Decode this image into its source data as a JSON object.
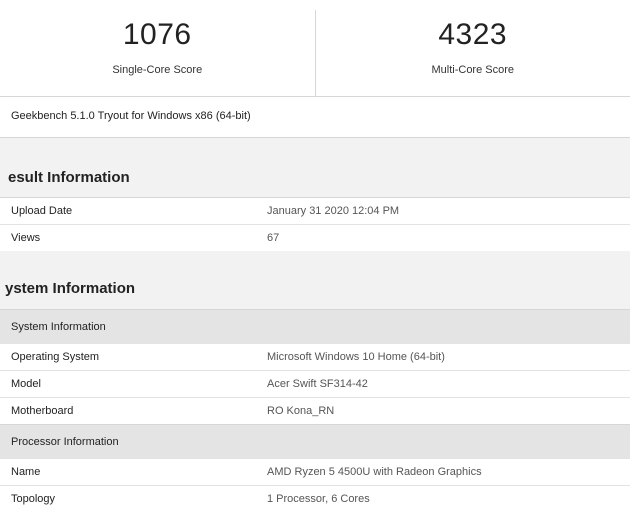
{
  "scores": {
    "single_core": {
      "value": "1076",
      "label": "Single-Core Score"
    },
    "multi_core": {
      "value": "4323",
      "label": "Multi-Core Score"
    }
  },
  "version": "Geekbench 5.1.0 Tryout for Windows x86 (64-bit)",
  "result_information": {
    "title": "esult Information",
    "rows": [
      {
        "name": "Upload Date",
        "value": "January 31 2020 12:04 PM"
      },
      {
        "name": "Views",
        "value": "67"
      }
    ]
  },
  "system_information": {
    "title": "ystem Information",
    "groups": [
      {
        "header": "System Information",
        "rows": [
          {
            "name": "Operating System",
            "value": "Microsoft Windows 10 Home (64-bit)"
          },
          {
            "name": "Model",
            "value": "Acer Swift SF314-42"
          },
          {
            "name": "Motherboard",
            "value": "RO Kona_RN"
          }
        ]
      },
      {
        "header": "Processor Information",
        "rows": [
          {
            "name": "Name",
            "value": "AMD Ryzen 5 4500U with Radeon Graphics"
          },
          {
            "name": "Topology",
            "value": "1 Processor, 6 Cores"
          }
        ]
      }
    ]
  }
}
